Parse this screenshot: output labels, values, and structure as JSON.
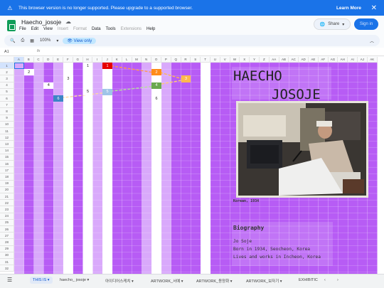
{
  "banner": {
    "message": "This browser version is no longer supported. Please upgrade to a supported browser.",
    "learn_more": "Learn More",
    "close": "✕"
  },
  "app": {
    "title": "Haecho_josoje"
  },
  "menus": [
    "File",
    "Edit",
    "View",
    "Insert",
    "Format",
    "Data",
    "Tools",
    "Extensions",
    "Help"
  ],
  "menus_disabled": [
    "Insert",
    "Format",
    "Extensions"
  ],
  "actions": {
    "share": "Share",
    "signin": "Sign in"
  },
  "toolbar": {
    "zoom": "100%",
    "view_only": "View only"
  },
  "formula_bar": {
    "cell_ref": "A1",
    "fx": "fx"
  },
  "columns": [
    "A",
    "B",
    "C",
    "D",
    "E",
    "F",
    "G",
    "H",
    "I",
    "J",
    "K",
    "L",
    "M",
    "N",
    "O",
    "P",
    "Q",
    "R",
    "S",
    "T",
    "U",
    "V",
    "W",
    "X",
    "Y",
    "Z",
    "AA",
    "AB",
    "AC",
    "AD",
    "AE",
    "AF",
    "AG",
    "AH",
    "AI",
    "AJ",
    "AK"
  ],
  "rows": [
    "1",
    "2",
    "3",
    "4",
    "5",
    "6",
    "7",
    "8",
    "9",
    "10",
    "11",
    "12",
    "13",
    "14",
    "15",
    "16",
    "17",
    "18",
    "19",
    "20",
    "21",
    "22",
    "23",
    "24",
    "25",
    "26",
    "27",
    "28",
    "29",
    "30",
    "31",
    "32"
  ],
  "cells": [
    {
      "text": "2",
      "col": "B",
      "row": 2,
      "bg": "#ffffff",
      "color": "#222222"
    },
    {
      "text": "1",
      "col": "H",
      "row": 1,
      "bg": "#ffffff",
      "color": "#222222"
    },
    {
      "text": "1",
      "col": "J",
      "row": 1,
      "bg": "#e60000",
      "color": "#ffffff"
    },
    {
      "text": "3",
      "col": "F",
      "row": 3,
      "bg": "#ffffff",
      "color": "#222222"
    },
    {
      "text": "4",
      "col": "D",
      "row": 4,
      "bg": "#ffffff",
      "color": "#222222"
    },
    {
      "text": "5",
      "col": "H",
      "row": 5,
      "bg": "#ffffff",
      "color": "#222222"
    },
    {
      "text": "2",
      "col": "O",
      "row": 2,
      "bg": "#ff8c1a",
      "color": "#ffffff"
    },
    {
      "text": "3",
      "col": "R",
      "row": 3,
      "bg": "#ffb84d",
      "color": "#ffffff"
    },
    {
      "text": "4",
      "col": "O",
      "row": 4,
      "bg": "#6aa84f",
      "color": "#ffffff"
    },
    {
      "text": "5",
      "col": "J",
      "row": 5,
      "bg": "#9fc5e8",
      "color": "#ffffff"
    },
    {
      "text": "6",
      "col": "E",
      "row": 6,
      "bg": "#3d85c6",
      "color": "#ffffff"
    },
    {
      "text": "6",
      "col": "O",
      "row": 6,
      "bg": "#ffffff",
      "color": "#222222"
    }
  ],
  "artwork": {
    "title_line1": "HAECHO",
    "title_line2": "JOSOJE",
    "caption": "Korean, 1934",
    "bio_heading": "Biography",
    "bio_lines": [
      "Jo Soje",
      "Born in 1934, Seocheon, Korea",
      "Lives and works in Incheon, Korea"
    ]
  },
  "sheet_tabs": [
    "THIS IS",
    "haecho_ josoje",
    "아이디어스케치",
    "ARTWORK_서예",
    "ARTWORK_동양화",
    "ARTWORK_보자기",
    "EXHIBITIC"
  ],
  "colors": {
    "purple": "#b75cf5",
    "light_purple": "#d9a9fb",
    "accent": "#1a73e8"
  }
}
